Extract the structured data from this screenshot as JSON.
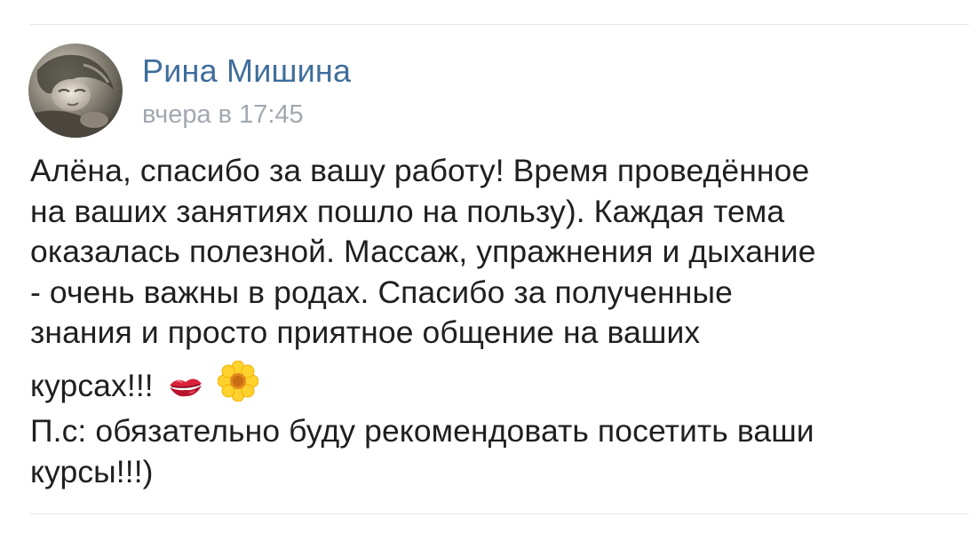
{
  "post": {
    "author": "Рина Мишина",
    "time": "вчера в 17:45",
    "lines": [
      "Алёна, спасибо за вашу работу! Время проведённое",
      "на ваших занятиях пошло на пользу). Каждая тема",
      "оказалась полезной. Массаж, упражнения и дыхание",
      "- очень важны в родах. Спасибо за полученные",
      "знания и просто приятное общение на ваших",
      "курсах!!!",
      "П.с: обязательно буду рекомендовать посетить ваши",
      "курсы!!!)"
    ],
    "emojis": [
      "kiss-mark",
      "sunflower"
    ]
  },
  "colors": {
    "author": "#3f6e9b",
    "timestamp": "#a2a8b0",
    "text": "#1f1f1f",
    "divider": "#e2e4e8"
  }
}
